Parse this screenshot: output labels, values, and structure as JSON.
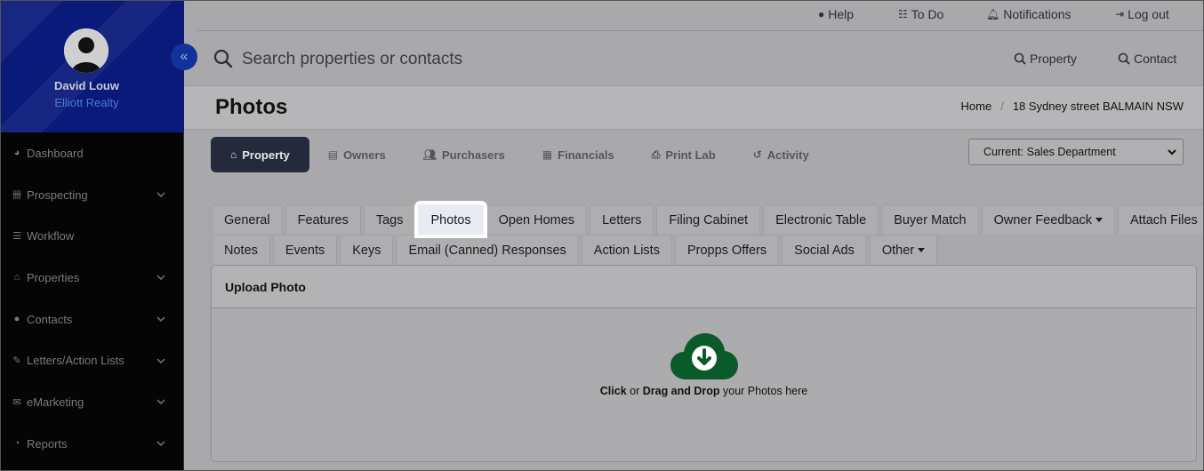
{
  "user": {
    "name": "David Louw",
    "company": "Elliott Realty"
  },
  "sidebar": {
    "collapse_icon": "double-chevron-left-icon",
    "items": [
      {
        "label": "Dashboard",
        "icon": "dashboard-icon",
        "has_children": false
      },
      {
        "label": "Prospecting",
        "icon": "prospecting-icon",
        "has_children": true
      },
      {
        "label": "Workflow",
        "icon": "list-icon",
        "has_children": false
      },
      {
        "label": "Properties",
        "icon": "home-icon",
        "has_children": true
      },
      {
        "label": "Contacts",
        "icon": "user-icon",
        "has_children": true
      },
      {
        "label": "Letters/Action Lists",
        "icon": "edit-icon",
        "has_children": true
      },
      {
        "label": "eMarketing",
        "icon": "envelope-icon",
        "has_children": true
      },
      {
        "label": "Reports",
        "icon": "chart-icon",
        "has_children": true
      }
    ]
  },
  "topbar": {
    "help": "Help",
    "todo": "To Do",
    "notifications": "Notifications",
    "logout": "Log out"
  },
  "search": {
    "placeholder": "Search properties or contacts",
    "property": "Property",
    "contact": "Contact"
  },
  "page": {
    "title": "Photos"
  },
  "breadcrumb": {
    "home": "Home",
    "separator": "/",
    "current": "18 Sydney street BALMAIN NSW"
  },
  "module_tabs": [
    {
      "label": "Property",
      "icon": "home-icon",
      "active": true
    },
    {
      "label": "Owners",
      "icon": "file-icon",
      "active": false
    },
    {
      "label": "Purchasers",
      "icon": "users-icon",
      "active": false
    },
    {
      "label": "Financials",
      "icon": "calculator-icon",
      "active": false
    },
    {
      "label": "Print Lab",
      "icon": "printer-icon",
      "active": false
    },
    {
      "label": "Activity",
      "icon": "history-icon",
      "active": false
    }
  ],
  "department_select": {
    "value": "Current: Sales Department"
  },
  "sub_tabs_row1": [
    {
      "label": "General"
    },
    {
      "label": "Features"
    },
    {
      "label": "Tags"
    },
    {
      "label": "Photos",
      "active": true
    },
    {
      "label": "Open Homes"
    },
    {
      "label": "Letters"
    },
    {
      "label": "Filing Cabinet"
    },
    {
      "label": "Electronic Table"
    },
    {
      "label": "Buyer Match"
    },
    {
      "label": "Owner Feedback",
      "dropdown": true
    },
    {
      "label": "Attach Files"
    }
  ],
  "sub_tabs_row2": [
    {
      "label": "Notes"
    },
    {
      "label": "Events"
    },
    {
      "label": "Keys"
    },
    {
      "label": "Email (Canned) Responses"
    },
    {
      "label": "Action Lists"
    },
    {
      "label": "Propps Offers"
    },
    {
      "label": "Social Ads"
    },
    {
      "label": "Other",
      "dropdown": true
    }
  ],
  "upload": {
    "heading": "Upload Photo",
    "icon": "cloud-download-icon",
    "click": "Click",
    "or": " or ",
    "drag": "Drag and Drop",
    "rest": " your Photos here"
  },
  "colors": {
    "active_tab_bg": "#24293b",
    "sidebar_profile_bg": "#0a1a7a",
    "cloud_green": "#0b5a2a"
  }
}
